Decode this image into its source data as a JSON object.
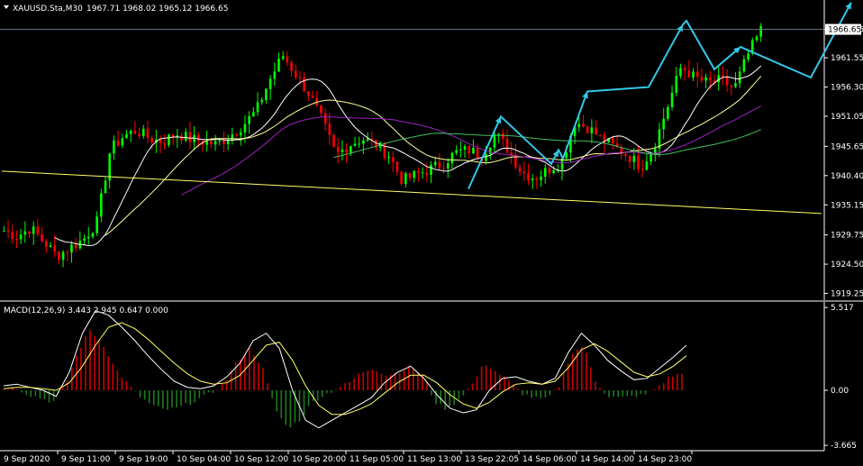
{
  "window": {
    "symbol_header": "XAUUSD.Sta,M30",
    "ohlc": "1967.71 1968.02 1965.12 1966.65",
    "current_price_label": "1966.65"
  },
  "colors": {
    "background": "#000000",
    "bull_candle": "#00ff00",
    "bear_candle": "#ff0000",
    "ma_fast": "#ffffff",
    "ma_slow": "#ffff99",
    "ma_purple": "#a020c0",
    "ma_green": "#40c060",
    "trendline": "#ffff66",
    "forecast": "#33c8e8",
    "macd_pos_hist": "#cc0000",
    "macd_neg_hist": "#1f7a1f",
    "macd_line": "#ffffff",
    "signal_line": "#ffff66",
    "axis": "#ffffff"
  },
  "chart_data": [
    {
      "type": "candlestick",
      "title": "XAUUSD.Sta,M30",
      "price_axis_ticks": [
        "1966.65",
        "1961.55",
        "1956.30",
        "1951.05",
        "1945.65",
        "1940.40",
        "1935.15",
        "1929.75",
        "1924.50",
        "1919.25"
      ],
      "ylim": [
        1918.2,
        1971.6
      ],
      "x_labels": [
        "9 Sep 2020",
        "9 Sep 11:00",
        "9 Sep 19:00",
        "10 Sep 04:00",
        "10 Sep 12:00",
        "10 Sep 20:00",
        "11 Sep 05:00",
        "11 Sep 13:00",
        "13 Sep 22:05",
        "14 Sep 06:00",
        "14 Sep 14:00",
        "14 Sep 23:00"
      ],
      "price_path": [
        1930.5,
        1929.5,
        1931.0,
        1928.5,
        1926.0,
        1927.5,
        1929.0,
        1932.0,
        1945.0,
        1947.5,
        1948.5,
        1947.0,
        1946.5,
        1948.0,
        1947.0,
        1946.5,
        1946.0,
        1947.5,
        1949.5,
        1952.0,
        1957.5,
        1962.0,
        1958.5,
        1955.0,
        1950.0,
        1944.0,
        1946.0,
        1947.0,
        1946.0,
        1944.0,
        1939.5,
        1940.5,
        1941.5,
        1942.5,
        1944.5,
        1945.0,
        1944.0,
        1948.0,
        1945.0,
        1941.0,
        1940.0,
        1941.5,
        1943.0,
        1950.0,
        1949.0,
        1947.0,
        1945.5,
        1944.0,
        1942.0,
        1946.0,
        1953.0,
        1960.0,
        1958.0,
        1957.0,
        1957.5,
        1956.0,
        1962.0,
        1966.5
      ],
      "moving_averages": [
        {
          "color_key": "ma_fast",
          "lag": 4
        },
        {
          "color_key": "ma_slow",
          "lag": 8
        },
        {
          "color_key": "ma_purple",
          "lag": 14
        },
        {
          "color_key": "ma_green",
          "lag": 26
        }
      ],
      "trendline": {
        "x": [
          "9 Sep 2020",
          "14 Sep 23:00"
        ],
        "y": [
          1941.2,
          1933.6
        ]
      },
      "forecast_path": {
        "y": [
          1938.0,
          1951.0,
          1942.5,
          1945.0,
          1943.5,
          1955.5,
          1956.3,
          1967.5,
          1968.2,
          1959.5,
          1963.5,
          1958.0,
          1971.5
        ]
      }
    },
    {
      "type": "bar",
      "title": "MACD(12,26,9) 3.443 2.945 0.647 0.000",
      "axis_ticks": [
        "5.517",
        "0.00",
        "-3.665"
      ],
      "ylim": [
        -3.9,
        5.7
      ],
      "histogram": [
        0.1,
        0.2,
        -0.3,
        -0.5,
        -0.8,
        0.3,
        2.5,
        4.0,
        3.2,
        1.5,
        0.5,
        -0.4,
        -1.0,
        -1.3,
        -1.2,
        -0.9,
        -0.5,
        -0.1,
        0.6,
        2.0,
        2.8,
        1.5,
        -1.2,
        -2.5,
        -2.0,
        -0.8,
        -0.3,
        0.1,
        0.5,
        1.2,
        1.5,
        1.0,
        1.2,
        1.6,
        1.0,
        -0.8,
        -1.3,
        -0.5,
        0.4,
        1.8,
        1.2,
        0.6,
        -0.2,
        -0.5,
        -0.6,
        0.2,
        2.4,
        3.0,
        0.6,
        -0.4,
        -0.5,
        -0.4,
        -0.3,
        0.2,
        0.9,
        1.1
      ],
      "macd_line": [
        0.3,
        0.4,
        0.2,
        0.0,
        -0.4,
        1.2,
        3.8,
        5.3,
        5.0,
        4.2,
        3.3,
        2.3,
        1.4,
        0.6,
        0.2,
        0.1,
        0.3,
        0.9,
        1.8,
        3.3,
        3.8,
        2.8,
        0.0,
        -2.0,
        -2.5,
        -2.0,
        -1.5,
        -1.0,
        -0.5,
        0.5,
        1.2,
        1.6,
        0.8,
        -0.3,
        -1.2,
        -1.5,
        -1.3,
        0.0,
        0.8,
        0.9,
        0.6,
        0.4,
        0.8,
        2.5,
        3.8,
        3.0,
        2.0,
        1.3,
        0.7,
        0.8,
        1.5,
        2.2,
        3.0
      ],
      "signal_line": [
        0.1,
        0.2,
        0.2,
        0.1,
        0.0,
        0.5,
        1.6,
        3.0,
        4.2,
        4.5,
        4.1,
        3.4,
        2.6,
        1.8,
        1.1,
        0.6,
        0.4,
        0.5,
        1.0,
        2.0,
        3.0,
        3.2,
        2.0,
        0.3,
        -1.0,
        -1.6,
        -1.6,
        -1.3,
        -0.9,
        -0.2,
        0.5,
        1.0,
        1.0,
        0.5,
        -0.3,
        -0.9,
        -1.2,
        -0.8,
        -0.1,
        0.4,
        0.5,
        0.4,
        0.6,
        1.5,
        2.7,
        3.1,
        2.6,
        1.9,
        1.2,
        0.9,
        1.1,
        1.6,
        2.3
      ]
    }
  ]
}
